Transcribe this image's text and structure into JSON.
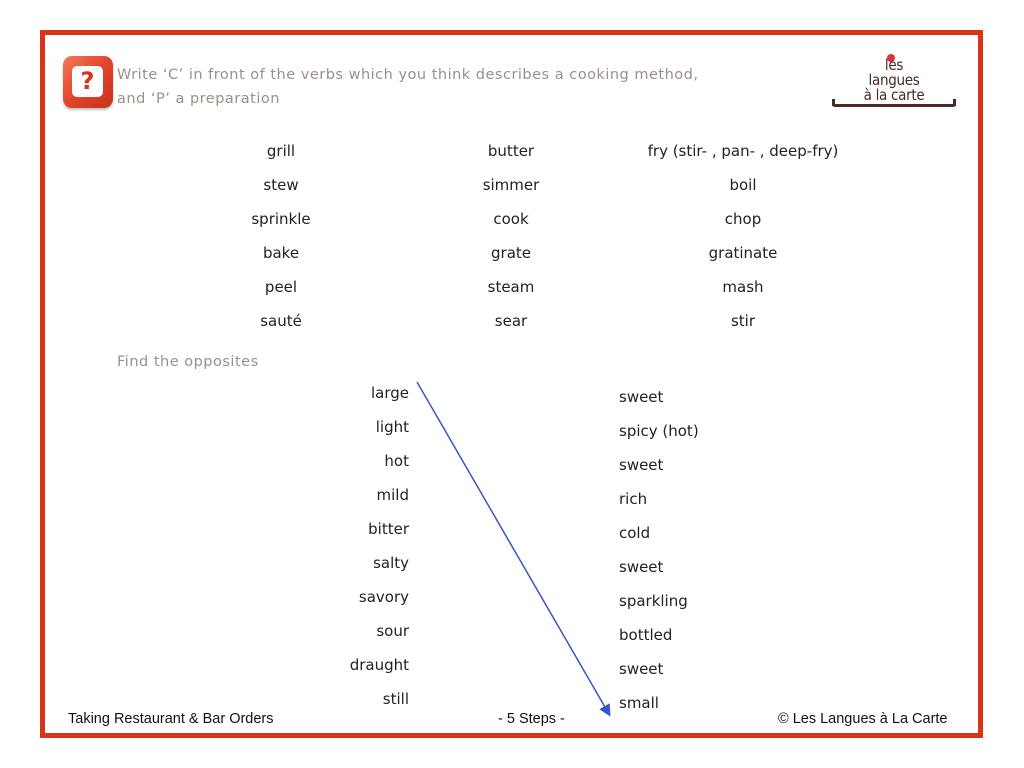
{
  "header": {
    "instruction_line1": "Write ‘C’ in front of the verbs which you think describes a cooking method,",
    "instruction_line2": "and ‘P’ a preparation",
    "icon": "question-mark-icon",
    "logo": {
      "line1": "les",
      "line2": "langues",
      "line3": "à la carte"
    }
  },
  "verbs": {
    "columns": [
      [
        "grill",
        "stew",
        "sprinkle",
        "bake",
        "peel",
        "sauté"
      ],
      [
        "butter",
        "simmer",
        "cook",
        "grate",
        "steam",
        "sear"
      ],
      [
        "fry (stir- , pan- , deep-fry)",
        "boil",
        "chop",
        "gratinate",
        "mash",
        "stir"
      ]
    ]
  },
  "opposites": {
    "title": "Find the opposites",
    "left": [
      "large",
      "light",
      "hot",
      "mild",
      "bitter",
      "salty",
      "savory",
      "sour",
      "draught",
      "still"
    ],
    "right": [
      "sweet",
      "spicy (hot)",
      "sweet",
      "rich",
      "cold",
      "sweet",
      "sparkling",
      "bottled",
      "sweet",
      "small"
    ],
    "example_match": {
      "from": "large",
      "to": "small"
    }
  },
  "footer": {
    "left": "Taking Restaurant & Bar Orders",
    "center": "- 5 Steps -",
    "right": "© Les Langues à La Carte"
  },
  "colors": {
    "frame": "#d8341a",
    "instruction": "#9a8f8a",
    "arrow": "#3a55cc",
    "logo": "#4a2a22"
  }
}
